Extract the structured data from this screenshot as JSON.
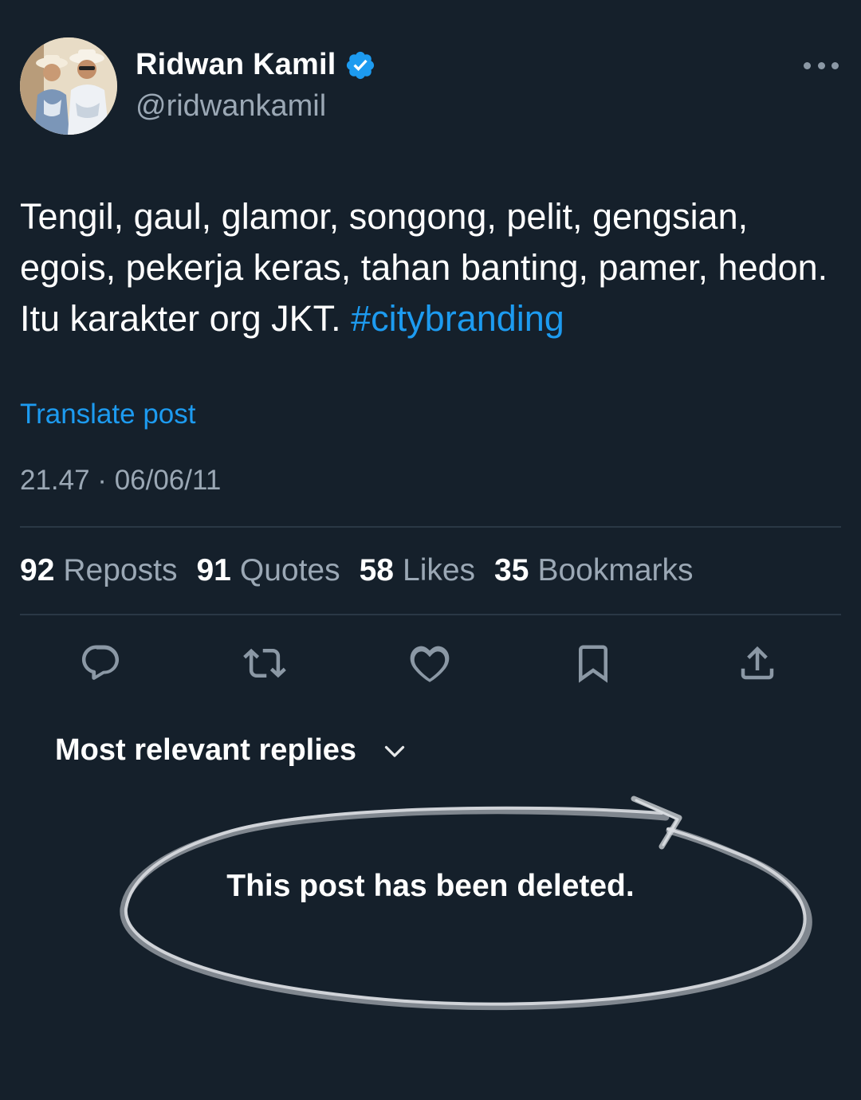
{
  "author": {
    "display_name": "Ridwan Kamil",
    "handle": "@ridwankamil",
    "verified": true,
    "avatar_icon": "profile-photo"
  },
  "post": {
    "text": "Tengil, gaul, glamor, songong, pelit, gengsian, egois, pekerja keras, tahan banting, pamer, hedon. Itu karakter org JKT. ",
    "hashtag": "#citybranding",
    "translate_label": "Translate post",
    "timestamp": "21.47 · 06/06/11"
  },
  "stats": [
    {
      "count": "92",
      "label": "Reposts"
    },
    {
      "count": "91",
      "label": "Quotes"
    },
    {
      "count": "58",
      "label": "Likes"
    },
    {
      "count": "35",
      "label": "Bookmarks"
    }
  ],
  "actions": [
    "reply-icon",
    "repost-icon",
    "like-icon",
    "bookmark-icon",
    "share-icon"
  ],
  "replies": {
    "sort_label": "Most relevant replies",
    "deleted_notice": "This post has been deleted."
  },
  "colors": {
    "background": "#15202b",
    "accent": "#1d9bf0",
    "secondary_text": "#9ba8b5",
    "divider": "#2a3845"
  }
}
